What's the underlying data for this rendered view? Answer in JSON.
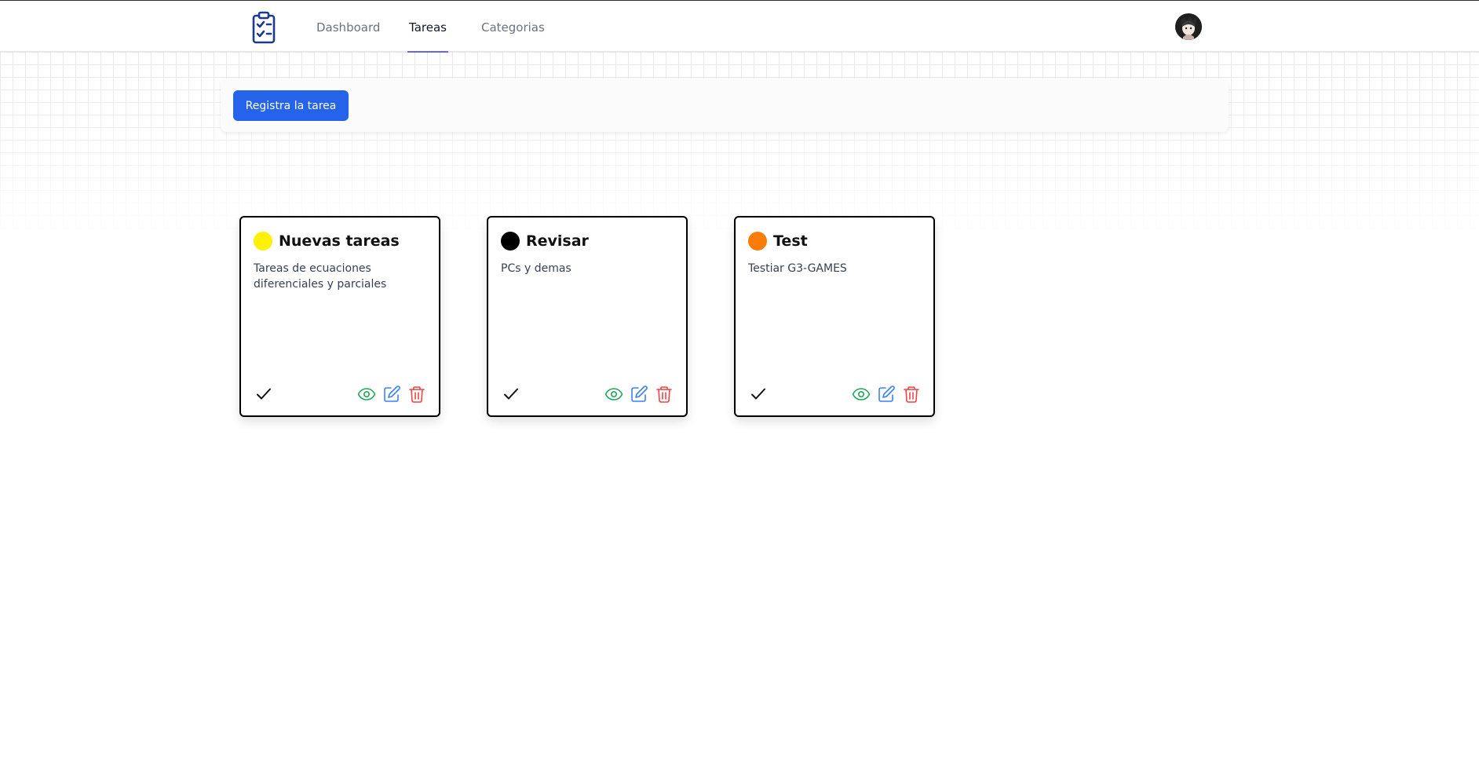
{
  "nav": {
    "links": [
      {
        "label": "Dashboard"
      },
      {
        "label": "Tareas"
      },
      {
        "label": "Categorias"
      }
    ],
    "active": "Tareas"
  },
  "toolbar": {
    "register_label": "Registra la tarea"
  },
  "tasks": [
    {
      "title": "Nuevas tareas",
      "description": "Tareas de ecuaciones diferenciales y parciales",
      "color": "#fff200"
    },
    {
      "title": "Revisar",
      "description": "PCs y demas",
      "color": "#000000"
    },
    {
      "title": "Test",
      "description": "Testiar G3-GAMES",
      "color": "#fb7c06"
    }
  ],
  "colors": {
    "accent": "#2563eb",
    "tab_underline": "#6366f1",
    "view_icon": "#22a55a",
    "edit_icon": "#3b82f6",
    "delete_icon": "#ef4444",
    "logo": "#1e3a8a"
  },
  "icons": {
    "logo": "clipboard-check-icon",
    "complete": "check-icon",
    "view": "eye-icon",
    "edit": "edit-icon",
    "delete": "trash-icon"
  }
}
